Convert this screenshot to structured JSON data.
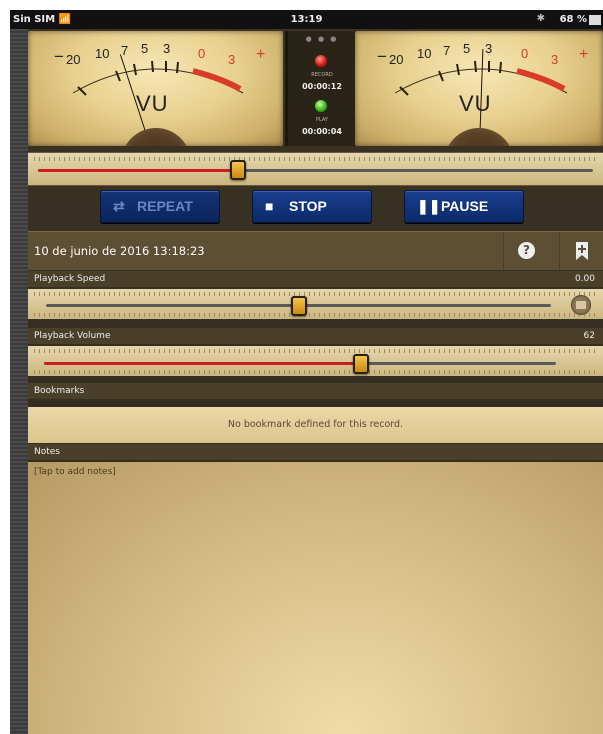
{
  "status_bar": {
    "carrier": "Sin SIM",
    "wifi_icon": "wifi-icon",
    "time": "13:19",
    "bluetooth_icon": "bluetooth-icon",
    "battery": "68 %"
  },
  "meters": {
    "scale_labels": [
      "20",
      "10",
      "7",
      "5",
      "3",
      "0",
      "3"
    ],
    "minus": "−",
    "plus": "+",
    "vu": "VU",
    "left_needle_deg": -18,
    "right_needle_deg": 2
  },
  "center_panel": {
    "record_label": "RECORD",
    "record_time": "00:00:12",
    "play_label": "PLAY",
    "play_time": "00:00:04"
  },
  "progress": {
    "fraction": 0.36
  },
  "transport": {
    "repeat_label": "REPEAT",
    "stop_label": "STOP",
    "pause_label": "PAUSE"
  },
  "recording": {
    "title": "10 de junio de 2016 13:18:23",
    "help_symbol": "?"
  },
  "playback_speed": {
    "label": "Playback Speed",
    "value": "0.00",
    "fraction": 0.5
  },
  "playback_volume": {
    "label": "Playback Volume",
    "value": "62",
    "fraction": 0.62
  },
  "bookmarks": {
    "label": "Bookmarks",
    "empty_text": "No bookmark defined for this record."
  },
  "notes": {
    "label": "Notes",
    "placeholder": "[Tap to add notes]"
  },
  "colors": {
    "accent_blue": "#123581",
    "panel_brown": "#5d4f33",
    "meter_red": "#d93a2a"
  }
}
